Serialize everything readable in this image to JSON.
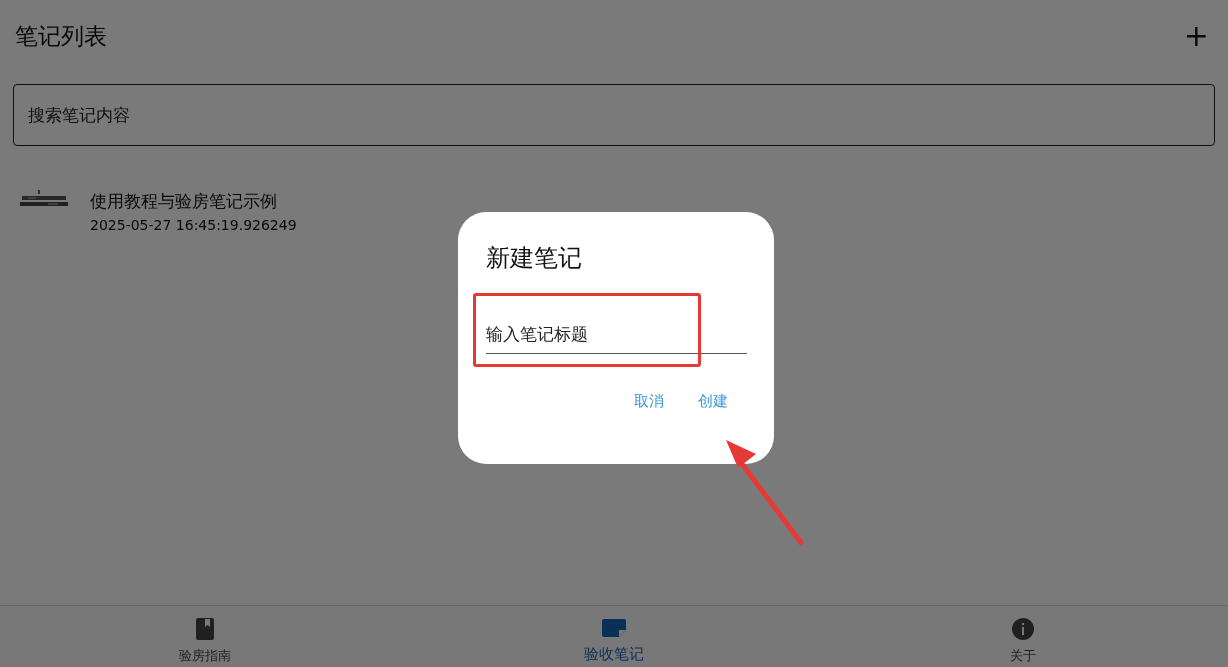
{
  "header": {
    "title": "笔记列表",
    "add_button": "+"
  },
  "search": {
    "placeholder": "搜索笔记内容"
  },
  "notes": [
    {
      "kind": "picture",
      "title": "使用教程与验房笔记示例",
      "date": "2025-05-27 16:45:19.926249"
    }
  ],
  "dialog": {
    "title": "新建笔记",
    "field": {
      "placeholder": "输入笔记标题"
    },
    "buttons": [
      "取消",
      "创建"
    ]
  },
  "bottom_nav": [
    {
      "label": "验房指南",
      "selected": false
    },
    {
      "label": "验收笔记",
      "selected": true
    },
    {
      "label": "关于",
      "selected": false
    }
  ]
}
